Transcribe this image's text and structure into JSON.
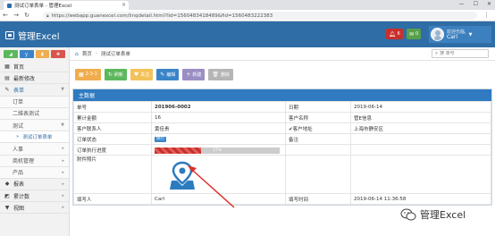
{
  "browser": {
    "tab_title": "测试订单表单 - 管理Excel",
    "url": "https://webapp.guanexcel.com/linqdetail.html?lid=1560483418489&fid=1560483222383",
    "win_min": "—",
    "win_max": "☐",
    "win_close": "✕"
  },
  "header": {
    "app_title": "管理Excel",
    "badge_red_count": "6",
    "badge_green_count": "0",
    "user_welcome": "欢迎光临,",
    "user_name": "Carl"
  },
  "sidebar": {
    "quick_buttons": [
      "◢",
      "ｙ",
      "▮",
      "✥"
    ],
    "items": [
      {
        "label": "首页",
        "icon": "▦"
      },
      {
        "label": "最新修改",
        "icon": "▤"
      },
      {
        "label": "表单",
        "icon": "✎"
      },
      {
        "label": "订单",
        "icon": ""
      },
      {
        "label": "二维表测试",
        "icon": ""
      },
      {
        "label": "测试",
        "icon": ""
      },
      {
        "label": "测试订单表单",
        "icon": "»"
      },
      {
        "label": "人事",
        "icon": ""
      },
      {
        "label": "商机管理",
        "icon": ""
      },
      {
        "label": "产品",
        "icon": ""
      },
      {
        "label": "报表",
        "icon": "◆"
      },
      {
        "label": "累计数",
        "icon": "◩"
      },
      {
        "label": "视图",
        "icon": "▼"
      }
    ]
  },
  "breadcrumb": {
    "home": "首页",
    "current": "测试订单表单"
  },
  "search": {
    "placeholder": "搜 单号"
  },
  "toolbar": {
    "b1": "2-3-1",
    "b2": "刷新",
    "b3": "关注",
    "b4": "编辑",
    "b5": "新建",
    "b6": "删除"
  },
  "panel": {
    "title": "主数据",
    "rows": [
      {
        "l1": "单号",
        "v1": "201906-0002",
        "l2": "日期",
        "v2": "2019-06-14"
      },
      {
        "l1": "累计金额",
        "v1": "16",
        "l2": "客户名称",
        "v2": "管E信息"
      },
      {
        "l1": "客户联系人",
        "v1": "黄佳贵",
        "l2": "✔客户地址",
        "v2": "上海市静安区"
      },
      {
        "l1": "订单状态",
        "v1": "执行",
        "l2": "备注",
        "v2": ""
      },
      {
        "l1": "订单执行进度",
        "v1": "37%",
        "l2": "",
        "v2": ""
      },
      {
        "l1": "附件照片",
        "v1": "",
        "l2": "",
        "v2": ""
      },
      {
        "l1": "填写人",
        "v1": "Carl",
        "l2": "填写时间",
        "v2": "2019-06-14 11:36:58"
      }
    ]
  },
  "progress_value": 0.37,
  "watermark": {
    "text": "管理Excel"
  }
}
